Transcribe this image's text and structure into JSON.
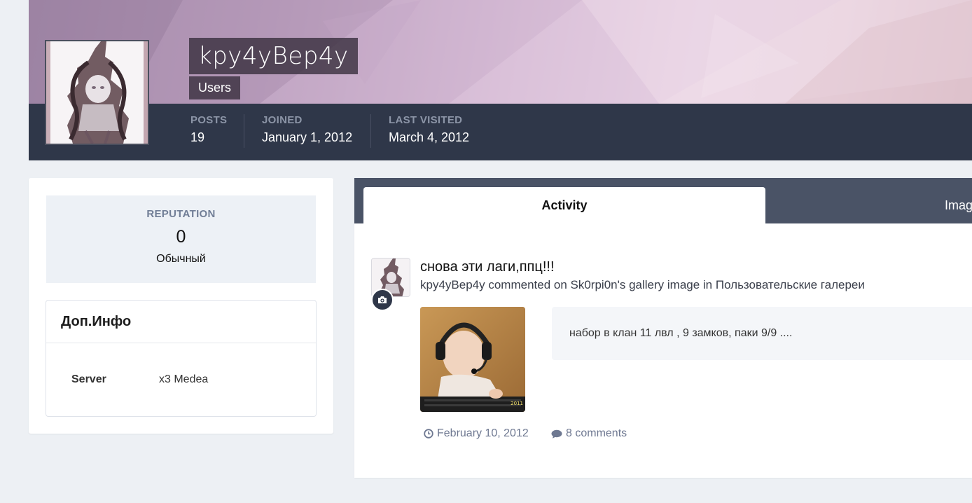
{
  "profile": {
    "username": "kpy4yBep4y",
    "group": "Users",
    "stats": [
      {
        "label": "POSTS",
        "value": "19"
      },
      {
        "label": "JOINED",
        "value": "January 1, 2012"
      },
      {
        "label": "LAST VISITED",
        "value": "March 4, 2012"
      }
    ]
  },
  "sidebar": {
    "reputation": {
      "title": "REPUTATION",
      "value": "0",
      "rank": "Обычный"
    },
    "info": {
      "title": "Доп.Инфо",
      "rows": [
        {
          "key": "Server",
          "value": "x3 Medea"
        }
      ]
    }
  },
  "tabs": [
    {
      "label": "Activity",
      "active": true
    },
    {
      "label": "Imag",
      "active": false
    }
  ],
  "feed": {
    "title": "снова эти лаги,ппц!!!",
    "meta": "kpy4yBep4y commented on Sk0rpi0n's gallery image in Пользовательские галереи",
    "quote": "набор в клан 11 лвл , 9 замков, паки 9/9 ....",
    "date": "February 10, 2012",
    "comments": "8 comments",
    "thumb_caption": "2011"
  },
  "icons": {
    "camera": "camera-icon",
    "clock": "clock-icon",
    "comment": "comment-icon"
  },
  "colors": {
    "header_bar": "#2f3749",
    "tabs_bar": "#4a5366",
    "page_bg": "#edf0f4"
  }
}
